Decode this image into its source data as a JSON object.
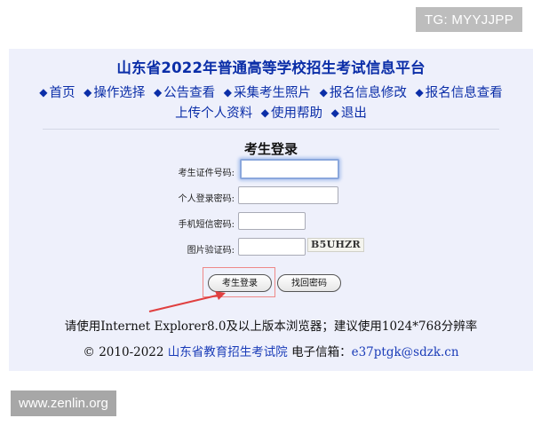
{
  "watermark_top": "TG: MYYJJPP",
  "watermark_bottom": "www.zenlin.org",
  "header": {
    "title": "山东省2022年普通高等学校招生考试信息平台"
  },
  "nav": {
    "bullet": "◆",
    "row1": [
      "首页",
      "操作选择",
      "公告查看",
      "采集考生照片",
      "报名信息修改",
      "报名信息查看"
    ],
    "row2": [
      "上传个人资料",
      "使用帮助",
      "退出"
    ]
  },
  "login": {
    "title": "考生登录",
    "fields": [
      {
        "label": "考生证件号码:",
        "value": ""
      },
      {
        "label": "个人登录密码:",
        "value": ""
      },
      {
        "label": "手机短信密码:",
        "value": ""
      },
      {
        "label": "图片验证码:",
        "value": ""
      }
    ],
    "captcha_text": "B5UHZR",
    "login_button": "考生登录",
    "recover_button": "找回密码"
  },
  "notice": "请使用Internet Explorer8.0及以上版本浏览器；建议使用1024*768分辨率",
  "footer": {
    "copyright": "© 2010-2022",
    "org_link": "山东省教育招生考试院",
    "email_label": "电子信箱：",
    "email": "e37ptgk@sdzk.cn"
  },
  "colors": {
    "panel_bg": "#eef0fb",
    "brand_blue": "#0b2ea8",
    "highlight_red": "#e04040"
  }
}
